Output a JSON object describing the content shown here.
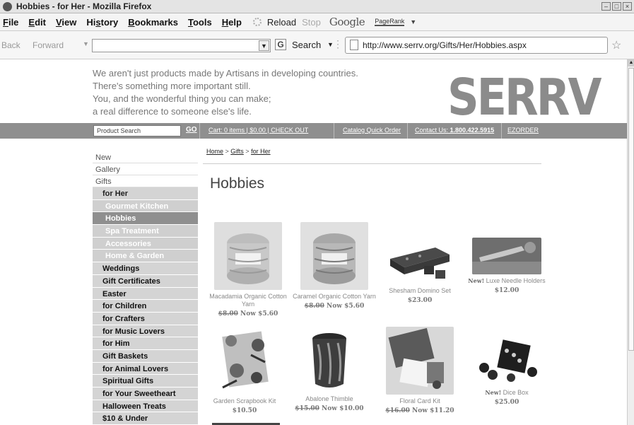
{
  "window": {
    "title": "Hobbies - for Her - Mozilla Firefox"
  },
  "menu": [
    {
      "label": "File",
      "key": "F"
    },
    {
      "label": "Edit",
      "key": "E"
    },
    {
      "label": "View",
      "key": "V"
    },
    {
      "label": "History",
      "key": "s"
    },
    {
      "label": "Bookmarks",
      "key": "B"
    },
    {
      "label": "Tools",
      "key": "T"
    },
    {
      "label": "Help",
      "key": "H"
    }
  ],
  "toolbar": {
    "reload": "Reload",
    "stop": "Stop",
    "google": "Google",
    "pagerank": "PageRank",
    "back": "Back",
    "forward": "Forward",
    "search_btn": "Search",
    "url": "http://www.serrv.org/Gifts/Her/Hobbies.aspx"
  },
  "site": {
    "tagline": [
      "We aren't just products made by Artisans in developing countries.",
      "There's something more important still.",
      "You, and the wonderful thing you can make;",
      "a real difference to someone else's life."
    ],
    "logo": "SERRV",
    "product_search": "Product Search",
    "go": "GO",
    "cart": "Cart:",
    "cart_detail": " 0 items | $0.00 | ",
    "checkout": "CHECK OUT",
    "catalog": "Catalog Quick Order",
    "contact": "Contact Us:",
    "phone": " 1.800.422.5915",
    "ezorder": "EZORDER"
  },
  "breadcrumb": {
    "home": "Home",
    "sep": " > ",
    "gifts": "Gifts",
    "her": "for Her"
  },
  "page_title": "Hobbies",
  "nav": {
    "top": [
      "New",
      "Gallery",
      "Gifts"
    ],
    "for_her": "for Her",
    "her_sub": [
      "Gourmet Kitchen",
      "Hobbies",
      "Spa Treatment",
      "Accessories",
      "Home & Garden"
    ],
    "categories": [
      "Weddings",
      "Gift Certificates",
      "Easter",
      "for Children",
      "for Crafters",
      "for Music Lovers",
      "for Him",
      "Gift Baskets",
      "for Animal Lovers",
      "Spiritual Gifts",
      "for Your Sweetheart",
      "Halloween Treats",
      "$10 & Under"
    ]
  },
  "products": [
    {
      "name": "Macadamia Organic Cotton Yarn",
      "old": "$8.00",
      "now": "Now $5.60"
    },
    {
      "name": "Caramel Organic Cotton Yarn",
      "old": "$8.00",
      "now": "Now $5.60"
    },
    {
      "name": "Shesham Domino Set",
      "price": "$23.00"
    },
    {
      "new": "New!",
      "name": "Luxe Needle Holders",
      "price": "$12.00"
    },
    {
      "name": "Garden Scrapbook Kit",
      "price": "$10.50"
    },
    {
      "name": "Abalone Thimble",
      "old": "$15.00",
      "now": "Now $10.00"
    },
    {
      "name": "Floral Card Kit",
      "old": "$16.00",
      "now": "Now $11.20"
    },
    {
      "new": "New!",
      "name": "Dice Box",
      "price": "$25.00"
    }
  ]
}
